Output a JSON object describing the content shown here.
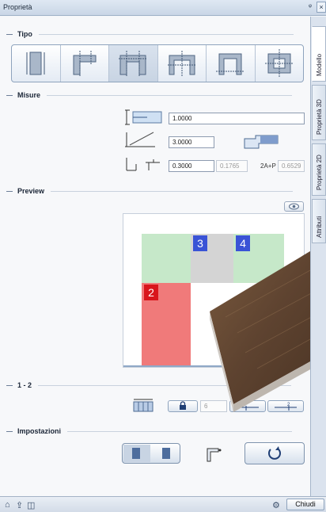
{
  "window": {
    "title": "Proprietà",
    "pin_glyph": "ᵠ",
    "close_glyph": "×"
  },
  "sections": {
    "tipo": "Tipo",
    "misure": "Misure",
    "preview": "Preview",
    "range": "1 - 2",
    "impostazioni": "Impostazioni"
  },
  "misure": {
    "width_value": "1.0000",
    "length_value": "3.0000",
    "thickness_value": "0.3000",
    "thickness_ro": "0.1765",
    "formula_label": "2A+P",
    "formula_value": "0.6529"
  },
  "preview": {
    "badges": [
      "3",
      "4",
      "2"
    ],
    "colors": {
      "green": "#c6e8c9",
      "grey": "#d4d4d4",
      "red": "#f07a7a",
      "blue_badge": "#3a53d6",
      "red_badge": "#d9161c"
    }
  },
  "range": {
    "lock_value": "6"
  },
  "sidetabs": [
    "Modello",
    "Proprietà 3D",
    "Proprietà 2D",
    "Attributi"
  ],
  "statusbar": {
    "close_label": "Chiudi"
  }
}
